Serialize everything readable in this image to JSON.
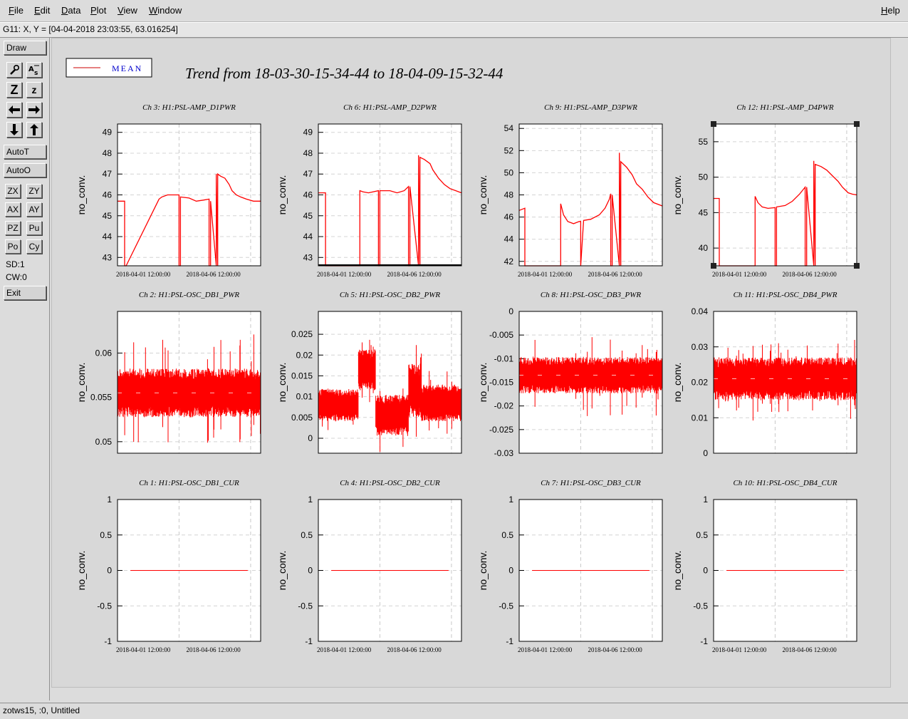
{
  "menu": {
    "file": "File",
    "edit": "Edit",
    "data": "Data",
    "plot": "Plot",
    "view": "View",
    "window": "Window",
    "help": "Help"
  },
  "coord_readout": "G11: X, Y = [04-04-2018 23:03:55, 63.016254]",
  "toolbar": {
    "draw": "Draw",
    "autot": "AutoT",
    "autoo": "AutoO",
    "zx": "ZX",
    "zy": "ZY",
    "ax": "AX",
    "ay": "AY",
    "pz": "PZ",
    "pu": "Pu",
    "po": "Po",
    "cy": "Cy",
    "sd": "SD:1",
    "cw": "CW:0",
    "exit": "Exit",
    "zoom_big": "Z",
    "zoom_small": "z"
  },
  "icons": {
    "magnify": "magnify-icon",
    "text": "text-style-icon",
    "left": "arrow-left-icon",
    "right": "arrow-right-icon",
    "down": "arrow-down-icon",
    "up": "arrow-up-icon"
  },
  "legend": {
    "label": "MEAN",
    "color": "#cc0000"
  },
  "trend_title": "Trend from 18-03-30-15-34-44 to 18-04-09-15-32-44",
  "status": "zotws15, :0, Untitled",
  "series_color": "#ff0000",
  "chart_data": [
    {
      "type": "line",
      "title": "Ch 3: H1:PSL-AMP_D1PWR",
      "ylabel": "no_conv.",
      "yticks": [
        "49",
        "48",
        "47",
        "46",
        "45",
        "44",
        "43"
      ],
      "xticks": [
        "2018-04-01 12:00:00",
        "2018-04-06 12:00:00"
      ],
      "ylim": [
        42.6,
        49.4
      ],
      "style": "amp",
      "x": [
        0,
        0.05,
        0.05,
        0.06,
        0.06,
        0.29,
        0.31,
        0.35,
        0.4,
        0.43,
        0.43,
        0.44,
        0.44,
        0.5,
        0.55,
        0.6,
        0.64,
        0.64,
        0.65,
        0.65,
        0.69,
        0.69,
        0.7,
        0.7,
        0.72,
        0.75,
        0.78,
        0.8,
        0.83,
        0.86,
        0.9,
        0.95,
        1.0
      ],
      "y": [
        45.7,
        45.7,
        42.6,
        42.6,
        42.6,
        45.8,
        45.9,
        46.0,
        46.0,
        46.0,
        42.6,
        42.6,
        45.9,
        45.85,
        45.7,
        45.75,
        45.8,
        42.6,
        42.6,
        45.7,
        42.6,
        47.0,
        42.6,
        47.0,
        46.9,
        46.8,
        46.5,
        46.2,
        46.0,
        45.9,
        45.8,
        45.7,
        45.7
      ]
    },
    {
      "type": "line",
      "title": "Ch 6: H1:PSL-AMP_D2PWR",
      "ylabel": "no_conv.",
      "yticks": [
        "49",
        "48",
        "47",
        "46",
        "45",
        "44",
        "43"
      ],
      "xticks": [
        "2018-04-01 12:00:00",
        "2018-04-06 12:00:00"
      ],
      "ylim": [
        42.6,
        49.4
      ],
      "style": "amp",
      "x": [
        0,
        0.05,
        0.05,
        0.06,
        0.29,
        0.29,
        0.31,
        0.35,
        0.42,
        0.42,
        0.43,
        0.43,
        0.5,
        0.55,
        0.6,
        0.63,
        0.63,
        0.64,
        0.64,
        0.7,
        0.7,
        0.71,
        0.71,
        0.74,
        0.78,
        0.8,
        0.84,
        0.88,
        0.92,
        0.96,
        1.0
      ],
      "y": [
        46.1,
        46.1,
        42.6,
        42.6,
        42.6,
        46.2,
        46.15,
        46.1,
        46.2,
        42.6,
        42.6,
        46.2,
        46.2,
        46.1,
        46.2,
        46.4,
        42.6,
        42.6,
        46.4,
        42.6,
        47.9,
        42.6,
        47.8,
        47.7,
        47.5,
        47.2,
        46.8,
        46.5,
        46.3,
        46.2,
        46.1
      ]
    },
    {
      "type": "line",
      "title": "Ch 9: H1:PSL-AMP_D3PWR",
      "ylabel": "no_conv.",
      "yticks": [
        "54",
        "52",
        "50",
        "48",
        "46",
        "44",
        "42"
      ],
      "xticks": [
        "2018-04-01 12:00:00",
        "2018-04-06 12:00:00"
      ],
      "ylim": [
        41.6,
        54.4
      ],
      "style": "amp",
      "x": [
        0,
        0.04,
        0.04,
        0.05,
        0.29,
        0.29,
        0.31,
        0.34,
        0.38,
        0.42,
        0.43,
        0.43,
        0.45,
        0.5,
        0.56,
        0.6,
        0.63,
        0.64,
        0.64,
        0.65,
        0.65,
        0.7,
        0.7,
        0.71,
        0.71,
        0.75,
        0.79,
        0.82,
        0.86,
        0.9,
        0.94,
        1.0
      ],
      "y": [
        46.6,
        46.8,
        41.6,
        41.6,
        41.6,
        47.2,
        46.2,
        45.6,
        45.4,
        45.6,
        45.6,
        41.6,
        45.7,
        45.8,
        46.2,
        46.8,
        47.6,
        48.1,
        41.6,
        41.6,
        48.0,
        41.6,
        51.8,
        41.6,
        51.0,
        50.5,
        49.8,
        49.0,
        48.5,
        47.8,
        47.3,
        47.0
      ]
    },
    {
      "type": "line",
      "title": "Ch 12: H1:PSL-AMP_D4PWR",
      "ylabel": "no_conv.",
      "yticks": [
        "55",
        "50",
        "45",
        "40"
      ],
      "xticks": [
        "2018-04-01 12:00:00",
        "2018-04-06 12:00:00"
      ],
      "ylim": [
        37.5,
        57.5
      ],
      "style": "amp",
      "selected": true,
      "x": [
        0,
        0.04,
        0.04,
        0.05,
        0.29,
        0.29,
        0.31,
        0.34,
        0.38,
        0.43,
        0.43,
        0.44,
        0.44,
        0.5,
        0.55,
        0.6,
        0.64,
        0.64,
        0.65,
        0.65,
        0.7,
        0.7,
        0.71,
        0.71,
        0.75,
        0.79,
        0.83,
        0.87,
        0.9,
        0.94,
        0.97,
        1.0
      ],
      "y": [
        47.0,
        47.0,
        37.5,
        37.5,
        37.5,
        47.3,
        46.4,
        45.8,
        45.6,
        45.7,
        37.5,
        37.5,
        45.8,
        46.0,
        46.6,
        47.6,
        48.6,
        37.5,
        37.5,
        48.6,
        37.5,
        52.3,
        37.5,
        51.8,
        51.5,
        51.0,
        50.2,
        49.4,
        48.6,
        47.8,
        47.6,
        47.5
      ]
    },
    {
      "type": "line",
      "title": "Ch 2: H1:PSL-OSC_DB1_PWR",
      "ylabel": "no_conv.",
      "yticks": [
        "0.06",
        "0.055",
        "0.05"
      ],
      "xticks": [],
      "ylim": [
        0.0487,
        0.0647
      ],
      "style": "noise",
      "center": 0.0555,
      "band": 0.0025,
      "spike": 0.004
    },
    {
      "type": "line",
      "title": "Ch 5: H1:PSL-OSC_DB2_PWR",
      "ylabel": "no_conv.",
      "yticks": [
        "0.025",
        "0.02",
        "0.015",
        "0.01",
        "0.005",
        "0"
      ],
      "xticks": [],
      "ylim": [
        -0.0036,
        0.0305
      ],
      "style": "noise_db2"
    },
    {
      "type": "line",
      "title": "Ch 8: H1:PSL-OSC_DB3_PWR",
      "ylabel": "no_conv.",
      "yticks": [
        "0",
        "-0.005",
        "-0.01",
        "-0.015",
        "-0.02",
        "-0.025",
        "-0.03"
      ],
      "xticks": [],
      "ylim": [
        -0.03,
        0.0
      ],
      "style": "noise",
      "center": -0.0135,
      "band": 0.0035,
      "spike": 0.005
    },
    {
      "type": "line",
      "title": "Ch 11: H1:PSL-OSC_DB4_PWR",
      "ylabel": "no_conv.",
      "yticks": [
        "0.04",
        "0.03",
        "0.02",
        "0.01",
        "0"
      ],
      "xticks": [],
      "ylim": [
        0.0,
        0.04
      ],
      "style": "noise",
      "center": 0.021,
      "band": 0.0055,
      "spike": 0.006
    },
    {
      "type": "line",
      "title": "Ch 1: H1:PSL-OSC_DB1_CUR",
      "ylabel": "no_conv.",
      "yticks": [
        "1",
        "0.5",
        "0",
        "-0.5",
        "-1"
      ],
      "xticks": [
        "2018-04-01 12:00:00",
        "2018-04-06 12:00:00"
      ],
      "ylim": [
        -1,
        1
      ],
      "style": "flat",
      "value": 0
    },
    {
      "type": "line",
      "title": "Ch 4: H1:PSL-OSC_DB2_CUR",
      "ylabel": "no_conv.",
      "yticks": [
        "1",
        "0.5",
        "0",
        "-0.5",
        "-1"
      ],
      "xticks": [
        "2018-04-01 12:00:00",
        "2018-04-06 12:00:00"
      ],
      "ylim": [
        -1,
        1
      ],
      "style": "flat",
      "value": 0
    },
    {
      "type": "line",
      "title": "Ch 7: H1:PSL-OSC_DB3_CUR",
      "ylabel": "no_conv.",
      "yticks": [
        "1",
        "0.5",
        "0",
        "-0.5",
        "-1"
      ],
      "xticks": [
        "2018-04-01 12:00:00",
        "2018-04-06 12:00:00"
      ],
      "ylim": [
        -1,
        1
      ],
      "style": "flat",
      "value": 0
    },
    {
      "type": "line",
      "title": "Ch 10: H1:PSL-OSC_DB4_CUR",
      "ylabel": "no_conv.",
      "yticks": [
        "1",
        "0.5",
        "0",
        "-0.5",
        "-1"
      ],
      "xticks": [
        "2018-04-01 12:00:00",
        "2018-04-06 12:00:00"
      ],
      "ylim": [
        -1,
        1
      ],
      "style": "flat",
      "value": 0
    }
  ]
}
